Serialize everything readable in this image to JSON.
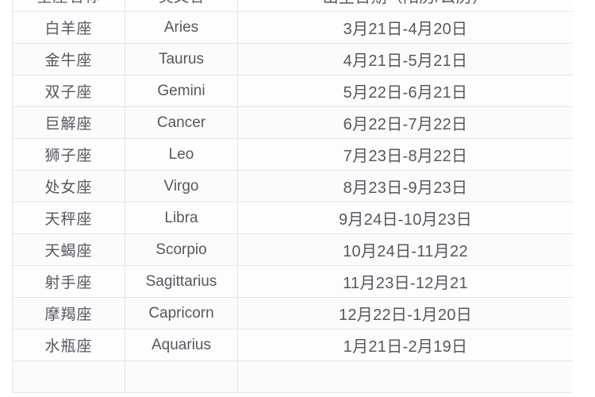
{
  "table": {
    "headers": {
      "chinese_name": "星座名称",
      "english_name": "英文名",
      "date_range": "出生日期（阳历/公历）"
    },
    "rows": [
      {
        "chinese_name": "白羊座",
        "english_name": "Aries",
        "date_range": "3月21日-4月20日"
      },
      {
        "chinese_name": "金牛座",
        "english_name": "Taurus",
        "date_range": "4月21日-5月21日"
      },
      {
        "chinese_name": "双子座",
        "english_name": "Gemini",
        "date_range": "5月22日-6月21日"
      },
      {
        "chinese_name": "巨解座",
        "english_name": "Cancer",
        "date_range": "6月22日-7月22日"
      },
      {
        "chinese_name": "狮子座",
        "english_name": "Leo",
        "date_range": "7月23日-8月22日"
      },
      {
        "chinese_name": "处女座",
        "english_name": "Virgo",
        "date_range": "8月23日-9月23日"
      },
      {
        "chinese_name": "天秤座",
        "english_name": "Libra",
        "date_range": "9月24日-10月23日"
      },
      {
        "chinese_name": "天蝎座",
        "english_name": "Scorpio",
        "date_range": "10月24日-11月22"
      },
      {
        "chinese_name": "射手座",
        "english_name": "Sagittarius",
        "date_range": "11月23日-12月21"
      },
      {
        "chinese_name": "摩羯座",
        "english_name": "Capricorn",
        "date_range": "12月22日-1月20日"
      },
      {
        "chinese_name": "水瓶座",
        "english_name": "Aquarius",
        "date_range": "1月21日-2月19日"
      }
    ],
    "trailing_row": {
      "chinese_name": "",
      "english_name": "",
      "date_range": ""
    }
  },
  "colors": {
    "text": "#55585e",
    "border": "#e3e5e8",
    "cell_background": "#fdfdfe",
    "page_background": "#ffffff"
  }
}
